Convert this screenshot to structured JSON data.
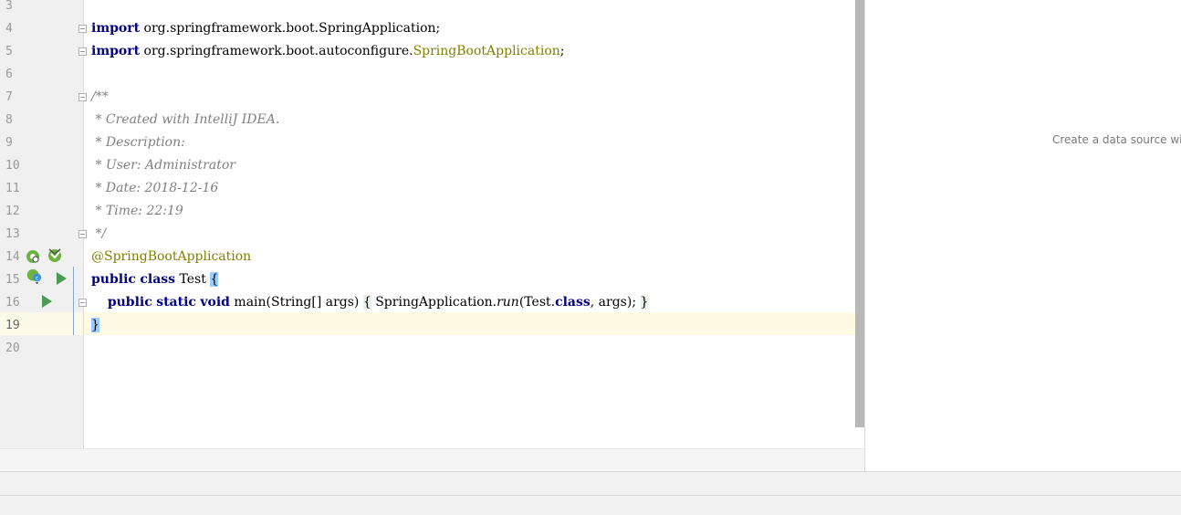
{
  "editor": {
    "line_numbers": [
      "3",
      "4",
      "5",
      "6",
      "7",
      "8",
      "9",
      "10",
      "11",
      "12",
      "13",
      "14",
      "15",
      "16",
      "19",
      "20"
    ],
    "lines": {
      "l4": {
        "kw": "import",
        "rest": " org.springframework.boot.SpringApplication;"
      },
      "l5": {
        "kw": "import",
        "rest_a": " org.springframework.boot.autoconfigure.",
        "unresolved": "SpringBootApplication",
        "rest_b": ";"
      },
      "l7": "/**",
      "l8": " * Created with IntelliJ IDEA.",
      "l9": " * Description:",
      "l10": " * User: Administrator",
      "l11": " * Date: 2018-12-16",
      "l12": " * Time: 22:19",
      "l13": " */",
      "l14": "@SpringBootApplication",
      "l15": {
        "kw1": "public",
        "kw2": "class",
        "name": " Test ",
        "brace": "{"
      },
      "l16": {
        "indent": "    ",
        "kw1": "public",
        "kw2": "static",
        "kw3": "void",
        "sig": " main(String[] args) ",
        "open": "{",
        "body_a": " SpringApplication.",
        "method": "run",
        "body_b": "(Test.",
        "kw4": "class",
        "body_c": ", args); ",
        "close": "}"
      },
      "l19": "}"
    }
  },
  "right_panel": {
    "hint": "Create a data source wit"
  },
  "colors": {
    "keyword": "#000080",
    "comment": "#808080",
    "annotation": "#808000",
    "current_line": "#fefae4",
    "brace_match": "#99ccff"
  },
  "icons": [
    "fold-marker-icon",
    "spring-bean-icon",
    "run-icon",
    "implemented-icon"
  ]
}
